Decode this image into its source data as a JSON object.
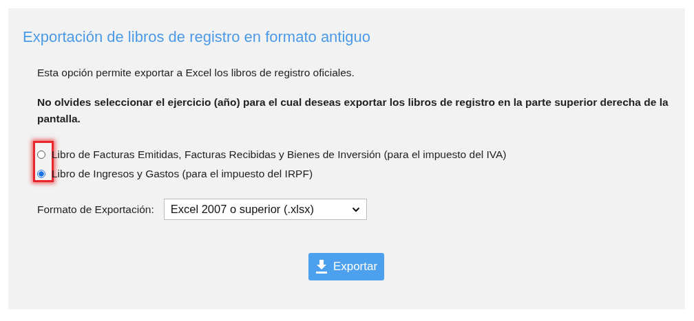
{
  "panel": {
    "title": "Exportación de libros de registro en formato antiguo",
    "intro": "Esta opción permite exportar a Excel los libros de registro oficiales.",
    "notice": "No olvides seleccionar el ejercicio (año) para el cual deseas exportar los libros de registro en la parte superior derecha de la pantalla.",
    "radio_highlight": true,
    "options": [
      {
        "label": "Libro de Facturas Emitidas, Facturas Recibidas y Bienes de Inversión (para el impuesto del IVA)",
        "selected": false
      },
      {
        "label": "Libro de Ingresos y Gastos (para el impuesto del IRPF)",
        "selected": true
      }
    ],
    "format": {
      "label": "Formato de Exportación:",
      "value": "Excel 2007 o superior (.xlsx)"
    },
    "export_button": "Exportar"
  }
}
